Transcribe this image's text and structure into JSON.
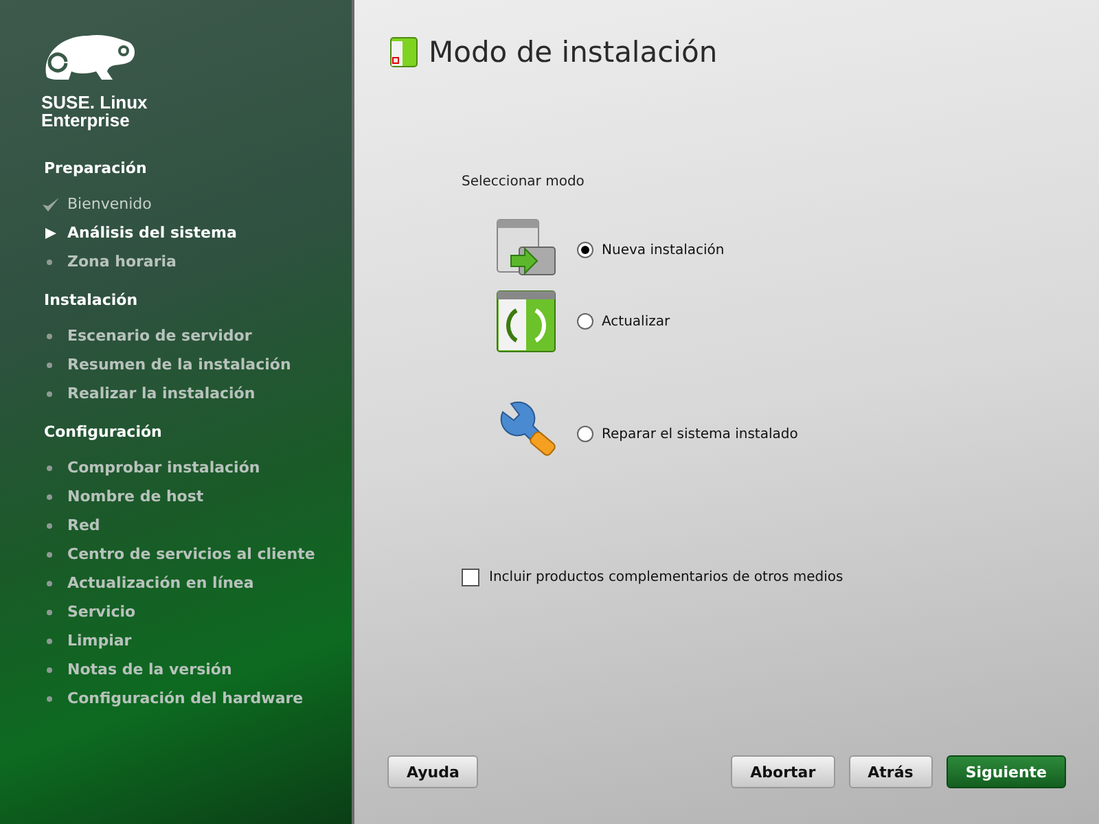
{
  "sidebar": {
    "logo_text": [
      "SUSE. Linux",
      "Enterprise"
    ],
    "sections": [
      {
        "title": "Preparación",
        "steps": [
          {
            "label": "Bienvenido",
            "done": true,
            "selected": false
          },
          {
            "label": "Análisis del sistema",
            "done": false,
            "selected": true
          },
          {
            "label": "Zona horaria",
            "done": false,
            "selected": false
          }
        ]
      },
      {
        "title": "Instalación",
        "steps": [
          {
            "label": "Escenario de servidor",
            "done": false,
            "selected": false
          },
          {
            "label": "Resumen de la instalación",
            "done": false,
            "selected": false
          },
          {
            "label": "Realizar la instalación",
            "done": false,
            "selected": false
          }
        ]
      },
      {
        "title": "Configuración",
        "steps": [
          {
            "label": "Comprobar instalación",
            "done": false,
            "selected": false
          },
          {
            "label": "Nombre de host",
            "done": false,
            "selected": false
          },
          {
            "label": "Red",
            "done": false,
            "selected": false
          },
          {
            "label": "Centro de servicios al cliente",
            "done": false,
            "selected": false
          },
          {
            "label": "Actualización en línea",
            "done": false,
            "selected": false
          },
          {
            "label": "Servicio",
            "done": false,
            "selected": false
          },
          {
            "label": "Limpiar",
            "done": false,
            "selected": false
          },
          {
            "label": "Notas de la versión",
            "done": false,
            "selected": false
          },
          {
            "label": "Configuración del hardware",
            "done": false,
            "selected": false
          }
        ]
      }
    ]
  },
  "page": {
    "title": "Modo de instalación",
    "group_label": "Seleccionar modo",
    "options": [
      {
        "kind": "new",
        "label": "Nueva instalación",
        "selected": true
      },
      {
        "kind": "update",
        "label": "Actualizar",
        "selected": false
      },
      {
        "kind": "repair",
        "label": "Reparar el sistema instalado",
        "selected": false
      }
    ],
    "addon": {
      "label": "Incluir productos complementarios de otros medios",
      "checked": false
    }
  },
  "buttons": [
    {
      "label": "Ayuda",
      "kind": "plain"
    },
    {
      "label": "Abortar",
      "kind": "plain"
    },
    {
      "label": "Atrás",
      "kind": "plain"
    },
    {
      "label": "Siguiente",
      "kind": "primary"
    }
  ]
}
